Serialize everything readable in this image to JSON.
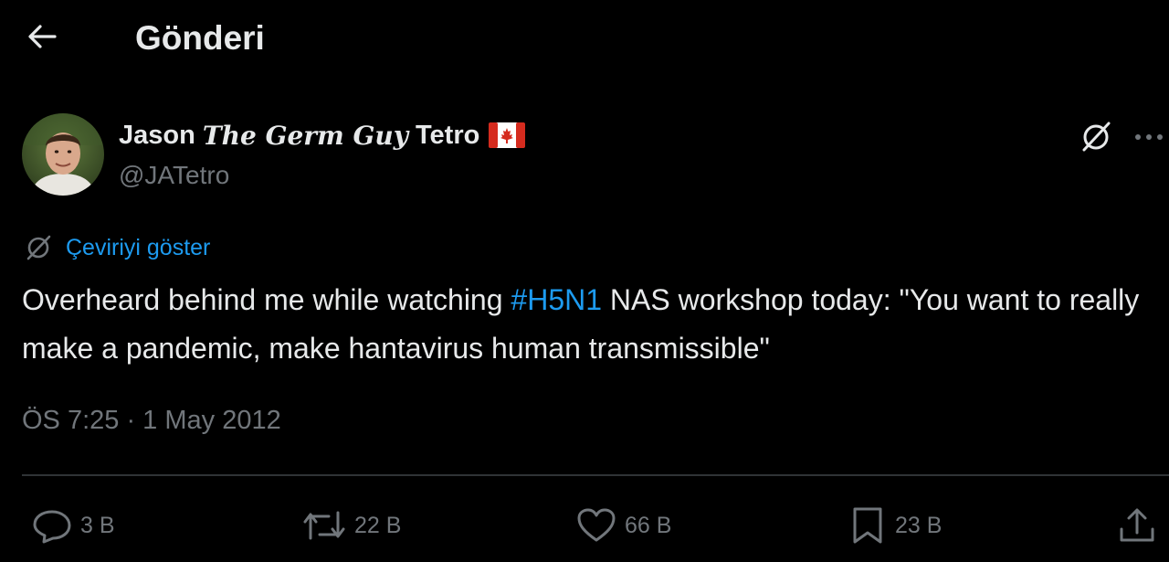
{
  "header": {
    "title": "Gönderi"
  },
  "author": {
    "name_first": "Jason",
    "name_fancy": "The Germ Guy",
    "name_last": "Tetro",
    "handle": "@JATetro",
    "flag": "canada-flag"
  },
  "translate": {
    "label": "Çeviriyi göster"
  },
  "tweet": {
    "text_before": "Overheard behind me while watching ",
    "hashtag": "#H5N1",
    "text_after": " NAS workshop today: \"You want to really make a pandemic, make hantavirus human transmissible\""
  },
  "timestamp": "ÖS 7:25 · 1 May 2012",
  "actions": {
    "replies": "3 B",
    "reposts": "22 B",
    "likes": "66 B",
    "bookmarks": "23 B"
  },
  "colors": {
    "background": "#000000",
    "text": "#e7e9ea",
    "muted": "#71767b",
    "accent": "#1d9bf0",
    "divider": "#2f3336"
  }
}
